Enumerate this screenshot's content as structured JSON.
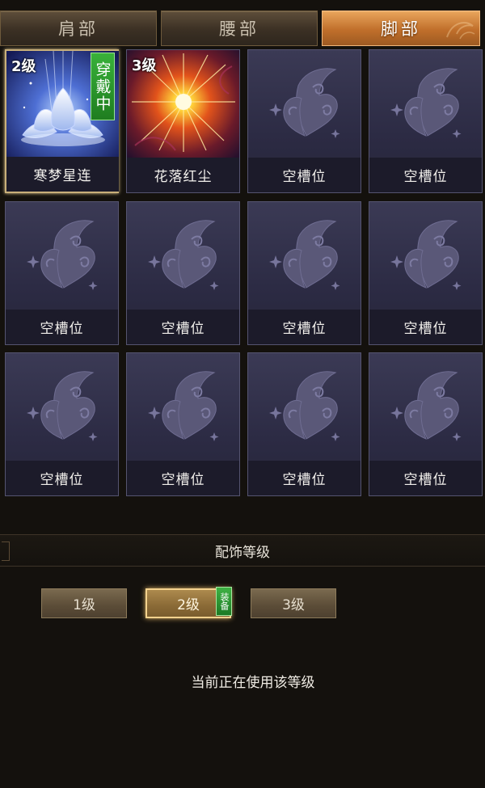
{
  "tabs": [
    {
      "label": "肩部",
      "active": false
    },
    {
      "label": "腰部",
      "active": false
    },
    {
      "label": "脚部",
      "active": true
    }
  ],
  "slots": [
    {
      "name": "寒梦星连",
      "level": "2级",
      "wearing": "穿戴中",
      "art": "lotus"
    },
    {
      "name": "花落红尘",
      "level": "3级",
      "art": "starburst"
    },
    {
      "name": "空槽位",
      "art": "butterfly"
    },
    {
      "name": "空槽位",
      "art": "butterfly"
    },
    {
      "name": "空槽位",
      "art": "butterfly"
    },
    {
      "name": "空槽位",
      "art": "butterfly"
    },
    {
      "name": "空槽位",
      "art": "butterfly"
    },
    {
      "name": "空槽位",
      "art": "butterfly"
    },
    {
      "name": "空槽位",
      "art": "butterfly"
    },
    {
      "name": "空槽位",
      "art": "butterfly"
    },
    {
      "name": "空槽位",
      "art": "butterfly"
    },
    {
      "name": "空槽位",
      "art": "butterfly"
    }
  ],
  "section": {
    "title": "配饰等级"
  },
  "levels": [
    {
      "label": "1级",
      "active": false
    },
    {
      "label": "2级",
      "active": true
    },
    {
      "label": "3级",
      "active": false
    }
  ],
  "equip_badge": "装备",
  "status_text": "当前正在使用该等级",
  "colors": {
    "accent": "#c06f2b",
    "wearing": "#2a962c",
    "slot_bg": "#2c2b44"
  }
}
